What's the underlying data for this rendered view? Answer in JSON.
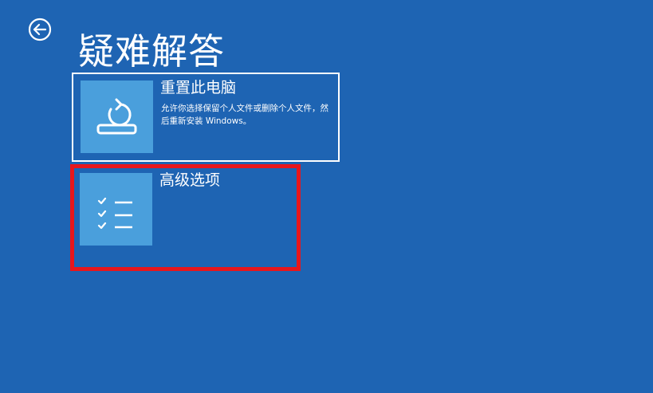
{
  "header": {
    "title": "疑难解答",
    "back_icon": "back-arrow-circle-icon"
  },
  "options": [
    {
      "title": "重置此电脑",
      "description": "允许你选择保留个人文件或删除个人文件，然后重新安装 Windows。",
      "icon": "reset-pc-icon"
    },
    {
      "title": "高级选项",
      "description": "",
      "icon": "checklist-icon"
    }
  ],
  "colors": {
    "background": "#1e64b3",
    "tile": "#4a9fdc",
    "text": "#ffffff",
    "highlight": "#e8161c"
  }
}
